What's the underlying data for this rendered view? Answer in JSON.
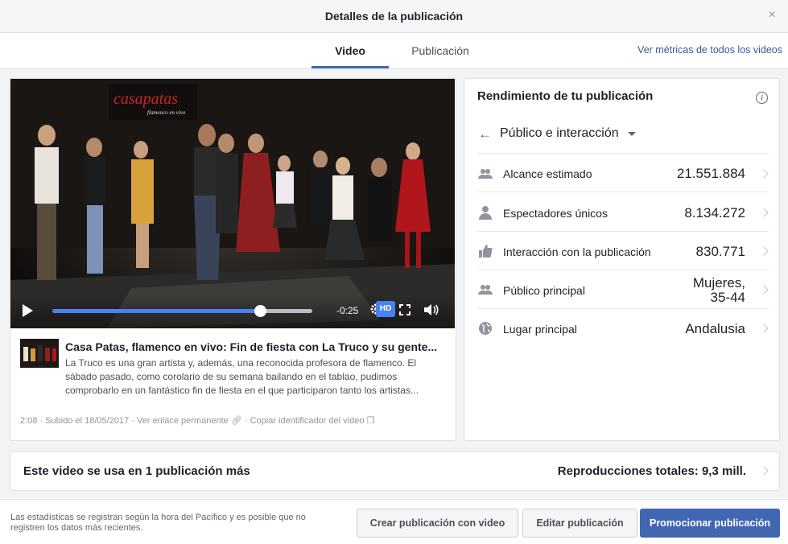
{
  "dialog": {
    "title": "Detalles de la publicación",
    "close_symbol": "×"
  },
  "tabs": [
    {
      "label": "Video",
      "active": true
    },
    {
      "label": "Publicación",
      "active": false
    }
  ],
  "metrics_link": "Ver métricas de todos los videos",
  "player": {
    "time_remaining": "-0:25",
    "hd_label": "HD",
    "progress_fraction": 0.8,
    "accent_color": "#4a80f5"
  },
  "video": {
    "title": "Casa Patas, flamenco en vivo: Fin de fiesta con La Truco y su gente...",
    "description": "La Truco es una gran artista y, además, una reconocida profesora de flamenco. El sábado pasado, como corolario de su semana bailando en el tablao, pudimos comprobarlo en un fantástico fin de fiesta en el que participaron tanto los artistas...",
    "duration": "2:08",
    "uploaded": "Subido el 18/05/2017",
    "permalink_label": "Ver enlace permanente",
    "copy_id_label": "Copiar identificador del video",
    "sign_text_line1": "casapatas",
    "sign_text_line2": "flamenco en vivo"
  },
  "performance": {
    "title": "Rendimiento de tu publicación",
    "info_symbol": "i",
    "dropdown_label": "Público e interacción",
    "rows": [
      {
        "icon": "people-icon",
        "label": "Alcance estimado",
        "value": "21.551.884"
      },
      {
        "icon": "person-icon",
        "label": "Espectadores únicos",
        "value": "8.134.272"
      },
      {
        "icon": "thumbs-up-icon",
        "label": "Interacción con la publicación",
        "value": "830.771"
      },
      {
        "icon": "people-icon",
        "label": "Público principal",
        "value_line1": "Mujeres,",
        "value_line2": "35-44"
      },
      {
        "icon": "globe-icon",
        "label": "Lugar principal",
        "value": "Andalusia"
      }
    ]
  },
  "usage": {
    "left_text": "Este video se usa en 1 publicación más",
    "right_text": "Reproducciones totales: 9,3 mill."
  },
  "footer": {
    "note": "Las estadísticas se registran según la hora del Pacífico y es posible que no registren los datos más recientes.",
    "create_button": "Crear publicación con video",
    "edit_button": "Editar publicación",
    "promote_button": "Promocionar publicación"
  },
  "colors": {
    "link": "#385898",
    "primary": "#4267b2",
    "tab_active": "#4267b2"
  }
}
